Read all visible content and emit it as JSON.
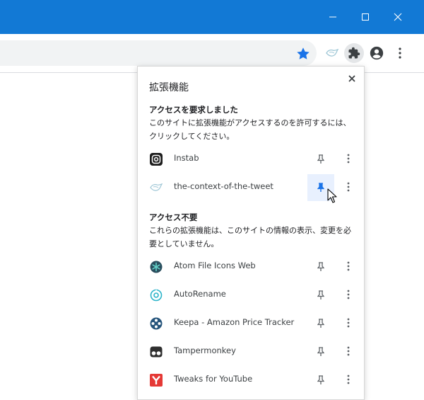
{
  "colors": {
    "titlebar": "#1279d5",
    "accent": "#1a73e8",
    "icon_gray": "#5f6368",
    "pin_active_bg": "#e8f0fe"
  },
  "window_controls": {
    "minimize_icon": "minimize-icon",
    "maximize_icon": "maximize-icon",
    "close_icon": "close-icon"
  },
  "toolbar": {
    "bookmark_icon": "star-icon",
    "extension_icon": "the-context-of-the-tweet-icon",
    "extensions_button_icon": "puzzle-icon",
    "profile_icon": "account-icon",
    "menu_icon": "kebab-icon"
  },
  "popup": {
    "title": "拡張機能",
    "requesting": {
      "heading": "アクセスを要求しました",
      "description": "このサイトに拡張機能がアクセスするのを許可するには、クリックしてください。",
      "items": [
        {
          "name": "Instab",
          "icon": "instab-icon",
          "pinned": false
        },
        {
          "name": "the-context-of-the-tweet",
          "icon": "the-context-of-the-tweet-icon",
          "pinned": true
        }
      ]
    },
    "no_access": {
      "heading": "アクセス不要",
      "description": "これらの拡張機能は、このサイトの情報の表示、変更を必要としていません。",
      "items": [
        {
          "name": "Atom File Icons Web",
          "icon": "atom-file-icons-icon",
          "pinned": false
        },
        {
          "name": "AutoRename",
          "icon": "autorename-icon",
          "pinned": false
        },
        {
          "name": "Keepa - Amazon Price Tracker",
          "icon": "keepa-icon",
          "pinned": false
        },
        {
          "name": "Tampermonkey",
          "icon": "tampermonkey-icon",
          "pinned": false
        },
        {
          "name": "Tweaks for YouTube",
          "icon": "tweaks-for-youtube-icon",
          "pinned": false
        }
      ]
    }
  }
}
